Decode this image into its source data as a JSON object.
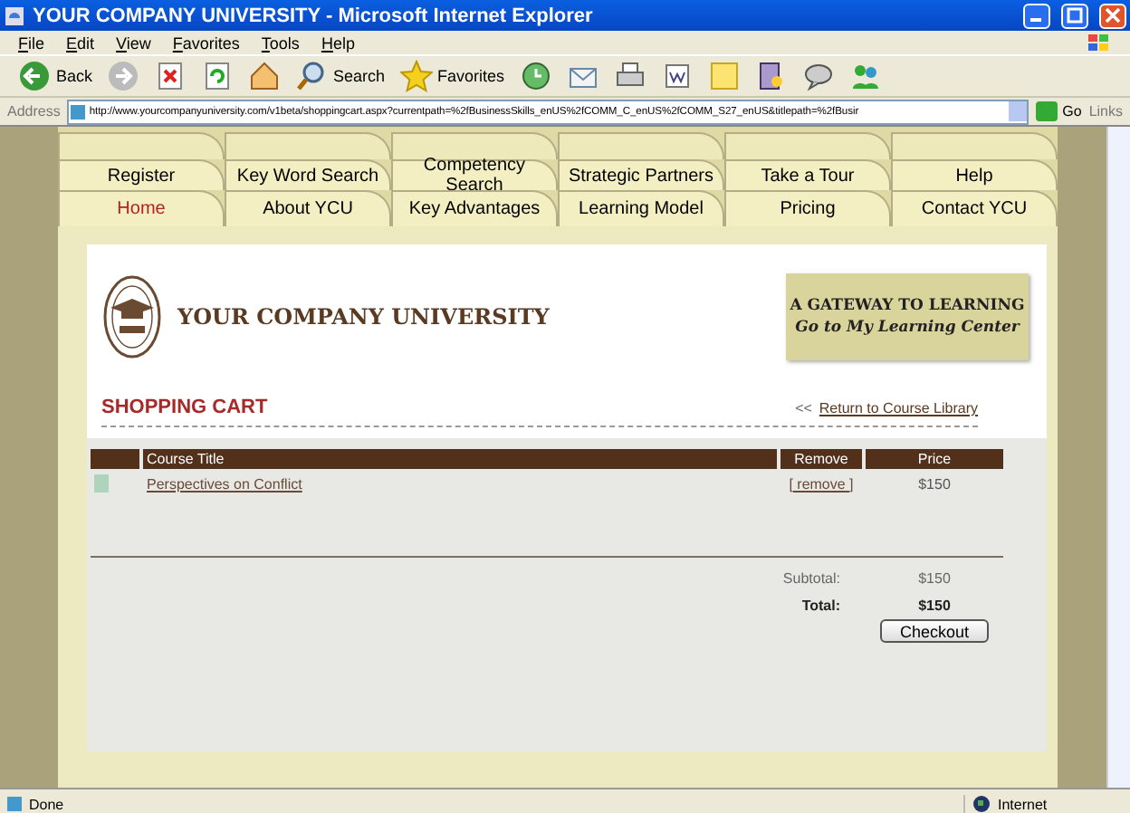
{
  "window": {
    "title": "YOUR COMPANY UNIVERSITY - Microsoft Internet Explorer"
  },
  "menu": [
    "File",
    "Edit",
    "View",
    "Favorites",
    "Tools",
    "Help"
  ],
  "toolbar": [
    {
      "kind": "back",
      "label": "Back"
    },
    {
      "kind": "forward"
    },
    {
      "kind": "stop"
    },
    {
      "kind": "refresh"
    },
    {
      "kind": "home"
    },
    {
      "kind": "search",
      "label": "Search"
    },
    {
      "kind": "favorites",
      "label": "Favorites"
    },
    {
      "kind": "history"
    },
    {
      "kind": "mail"
    },
    {
      "kind": "print"
    },
    {
      "kind": "edit"
    },
    {
      "kind": "note"
    },
    {
      "kind": "research"
    },
    {
      "kind": "messenger"
    },
    {
      "kind": "people"
    }
  ],
  "address": {
    "label": "Address",
    "url": "http://www.yourcompanyuniversity.com/v1beta/shoppingcart.aspx?currentpath=%2fBusinessSkills_enUS%2fCOMM_C_enUS%2fCOMM_S27_enUS&titlepath=%2fBusir",
    "go": "Go",
    "links": "Links"
  },
  "tab_rows": [
    [
      {
        "label": "Register",
        "selected": false
      },
      {
        "label": "Key Word Search",
        "selected": false
      },
      {
        "label": "Competency Search",
        "selected": false
      },
      {
        "label": "Strategic Partners",
        "selected": false
      },
      {
        "label": "Take a Tour",
        "selected": false
      },
      {
        "label": "Help",
        "selected": false
      }
    ],
    [
      {
        "label": "Home",
        "selected": true
      },
      {
        "label": "About YCU",
        "selected": false
      },
      {
        "label": "Key Advantages",
        "selected": false
      },
      {
        "label": "Learning Model",
        "selected": false
      },
      {
        "label": "Pricing",
        "selected": false
      },
      {
        "label": "Contact YCU",
        "selected": false
      }
    ]
  ],
  "site_title": "YOUR COMPANY UNIVERSITY",
  "banner": {
    "headline": "A GATEWAY TO LEARNING",
    "link": "Go to My Learning Center"
  },
  "heading": "SHOPPING CART",
  "return_link": {
    "prefix": "<<",
    "label": "Return to Course Library"
  },
  "table": {
    "columns": [
      "Course Title",
      "Remove",
      "Price"
    ],
    "rows": [
      {
        "title": "Perspectives on Conflict",
        "remove": "[ remove ]",
        "price": "$150"
      }
    ]
  },
  "summary": [
    {
      "label": "Subtotal:",
      "value": "$150",
      "bold": false
    },
    {
      "label": "Total:",
      "value": "$150",
      "bold": true
    }
  ],
  "checkout": "Checkout",
  "status_bar": {
    "text": "Done",
    "zone": "Internet"
  }
}
